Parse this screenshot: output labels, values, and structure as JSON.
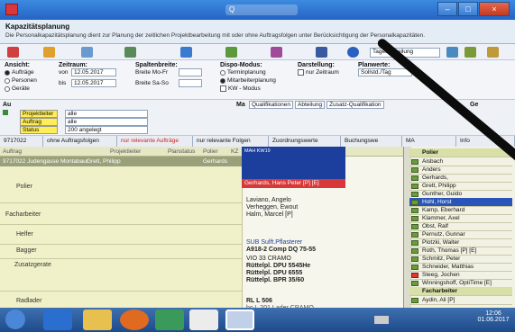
{
  "window": {
    "center_widget": "Q"
  },
  "header": {
    "title": "Kapazitätsplanung",
    "description": "Die Personalkapazitätsplanung dient zur Planung der zeitlichen Projektbearbeitung mit oder ohne Auftragsfolgen unter Berücksichtigung der Personalkapazitäten."
  },
  "toolbar": {
    "tageseinteilung": "Tageseinteilung"
  },
  "panel": {
    "ansicht": {
      "title": "Ansicht:",
      "options": [
        "Aufträge",
        "Personen",
        "Geräte"
      ]
    },
    "zeitraum": {
      "title": "Zeitraum:",
      "von_label": "von",
      "von": "12.05.2017",
      "bis_label": "bis",
      "bis": "12.05.2017"
    },
    "spaltenbreite": {
      "title": "Spaltenbreite:",
      "mofr": "Breite Mo-Fr",
      "saso": "Breite Sa-So"
    },
    "dispo": {
      "title": "Dispo-Modus:",
      "opt1": "Terminplanung",
      "opt2": "Mitarbeiterplanung",
      "opt3": "KW - Modus"
    },
    "darstellung": {
      "title": "Darstellung:",
      "opt1": "nur Zeitraum"
    },
    "planwerte": {
      "title": "Planwerte:",
      "value": "Sollstd./Tag"
    }
  },
  "filter": {
    "au": "Au",
    "rows": [
      {
        "label": "Projektleiter",
        "value": "alle"
      },
      {
        "label": "Auftrag",
        "value": "alle"
      },
      {
        "label": "Status",
        "value": "200 angelegt"
      }
    ],
    "ma": "Ma",
    "ma_tabs": [
      "Qualifikationen",
      "Abteilung",
      "Zusatz-Qualifikation"
    ],
    "ge": "Ge"
  },
  "tabs": [
    "9717022",
    "ohne Auftragsfolgen",
    "nur relevante Aufträge",
    "nur relevante Folgen",
    "Zuordnungswerte",
    "Buchungswe",
    "MA",
    "Info"
  ],
  "grid": {
    "headers": [
      "Auftrag",
      "Projektleiter",
      "Planstatus",
      "Polier",
      "KZ"
    ],
    "selected_row": "9717022 Judengasse Montabaur",
    "selected_pl": "Grett, Philipp",
    "selected_polier": "Gerhards",
    "roles": [
      "Polier",
      "Facharbeiter",
      "Helfer",
      "Bagger",
      "Zusatzgerate",
      "Radlader"
    ]
  },
  "assign": {
    "blue_text": "MAH KW19",
    "red_bar": "Gerhards, Hans Peter [P] [E]",
    "facharbeiter": [
      "Laviano, Angelo",
      "Verheggen, Ewout",
      "Halm, Marcel [P]"
    ],
    "bagger": [
      "SUB Sulft.Pflasterer",
      "A918-2 Comp DQ 75-55"
    ],
    "zusatz": [
      "VIO 33 CRAMO",
      "Rüttelpl. DPU 5545He",
      "Rüttelpl. DPU 6555",
      "Rüttelpl. BPR 35/60"
    ],
    "radlader": [
      "RL L 506",
      "bo L 201 Lader CRAMO"
    ]
  },
  "side": {
    "heading": "Polier",
    "items": [
      "Aisbach",
      "Anders",
      "Gerhards,",
      "Grett, Philipp",
      "Gunther, Guido",
      "Hohl, Horst",
      "Kamp, Eberhard",
      "Klammer, Axel",
      "Obst, Ralf",
      "Pernutz, Gunnar",
      "Plotzki, Walter",
      "Roth, Thomas [P] [E]",
      "Schmitz, Peter",
      "Schneider, Matthias",
      "Steeg, Jochen",
      "Winningshoff, OptiTime [E]",
      "Facharbeiter",
      "Aydin, Ali [P]"
    ]
  },
  "taskbar": {
    "time": "12:06",
    "date": "01.06.2017"
  }
}
